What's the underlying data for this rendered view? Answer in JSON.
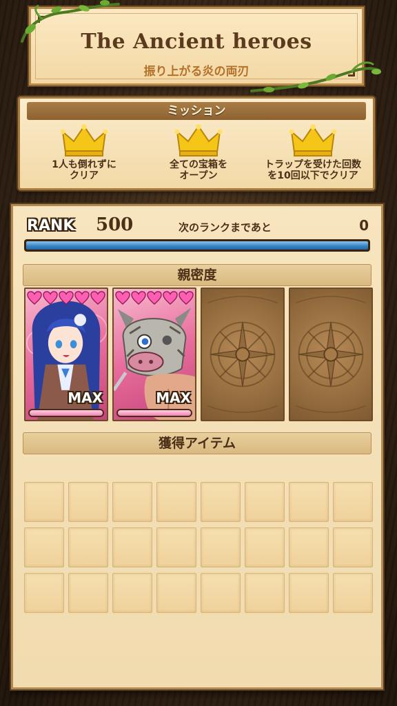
{
  "stage": {
    "title": "The Ancient heroes",
    "subtitle": "振り上がる炎の両刃"
  },
  "mission": {
    "header": "ミッション",
    "items": [
      {
        "line1": "1人も倒れずに",
        "line2": "クリア",
        "icon": "crown-icon"
      },
      {
        "line1": "全ての宝箱を",
        "line2": "オープン",
        "icon": "crown-icon"
      },
      {
        "line1": "トラップを受けた回数",
        "line2": "を10回以下でクリア",
        "icon": "crown-icon"
      }
    ]
  },
  "rank": {
    "label": "RANK",
    "value": "500",
    "next_label": "次のランクまであと",
    "next_value": "0",
    "exp_progress": 1.0
  },
  "affinity": {
    "header": "親密度",
    "cards": [
      {
        "state": "filled",
        "hearts": 5,
        "max_label": "MAX",
        "love_progress": 1.0,
        "character": "blue-haired-girl"
      },
      {
        "state": "filled",
        "hearts": 5,
        "max_label": "MAX",
        "love_progress": 1.0,
        "character": "boar-mask-warrior"
      },
      {
        "state": "empty"
      },
      {
        "state": "empty"
      }
    ]
  },
  "items": {
    "header": "獲得アイテム",
    "slot_count": 24
  },
  "colors": {
    "heart": "#ff5fb0",
    "exp_bar": "#3a86c8",
    "crown": "#f5c518"
  }
}
